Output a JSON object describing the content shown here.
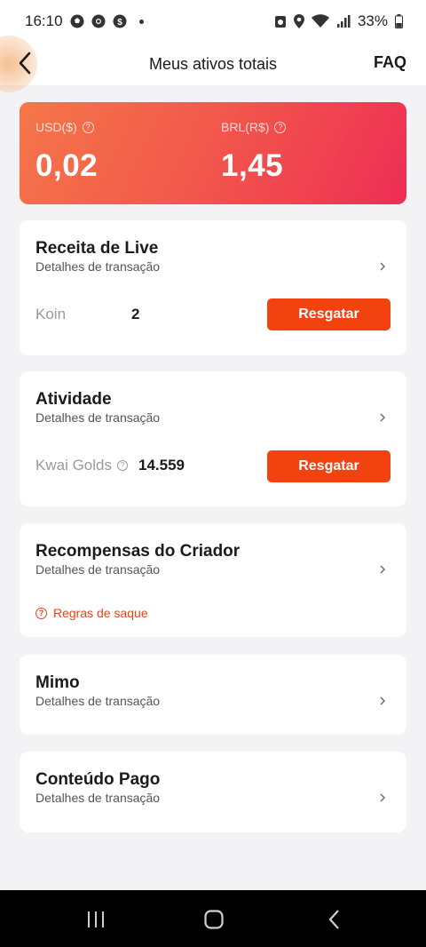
{
  "status_bar": {
    "time": "16:10",
    "battery": "33%",
    "notification_icons": [
      "soccer-icon",
      "chrome-icon",
      "dollar-icon"
    ]
  },
  "header": {
    "title": "Meus ativos totais",
    "faq_label": "FAQ"
  },
  "balances": {
    "usd_label": "USD($)",
    "usd_value": "0,02",
    "brl_label": "BRL(R$)",
    "brl_value": "1,45",
    "gradient": [
      "#f5764a",
      "#ee2e55"
    ]
  },
  "cards": [
    {
      "title": "Receita de Live",
      "subtitle": "Detalhes de transação",
      "row_label": "Koin",
      "row_value": "2",
      "button": "Resgatar"
    },
    {
      "title": "Atividade",
      "subtitle": "Detalhes de transação",
      "row_label": "Kwai Golds",
      "row_value": "14.559",
      "button": "Resgatar"
    },
    {
      "title": "Recompensas do Criador",
      "subtitle": "Detalhes de transação",
      "link": "Regras de saque"
    },
    {
      "title": "Mimo",
      "subtitle": "Detalhes de transação"
    },
    {
      "title": "Conteúdo Pago",
      "subtitle": "Detalhes de transação"
    }
  ],
  "colors": {
    "accent": "#f2420f",
    "link": "#e8421b",
    "background": "#f3f3f5"
  }
}
